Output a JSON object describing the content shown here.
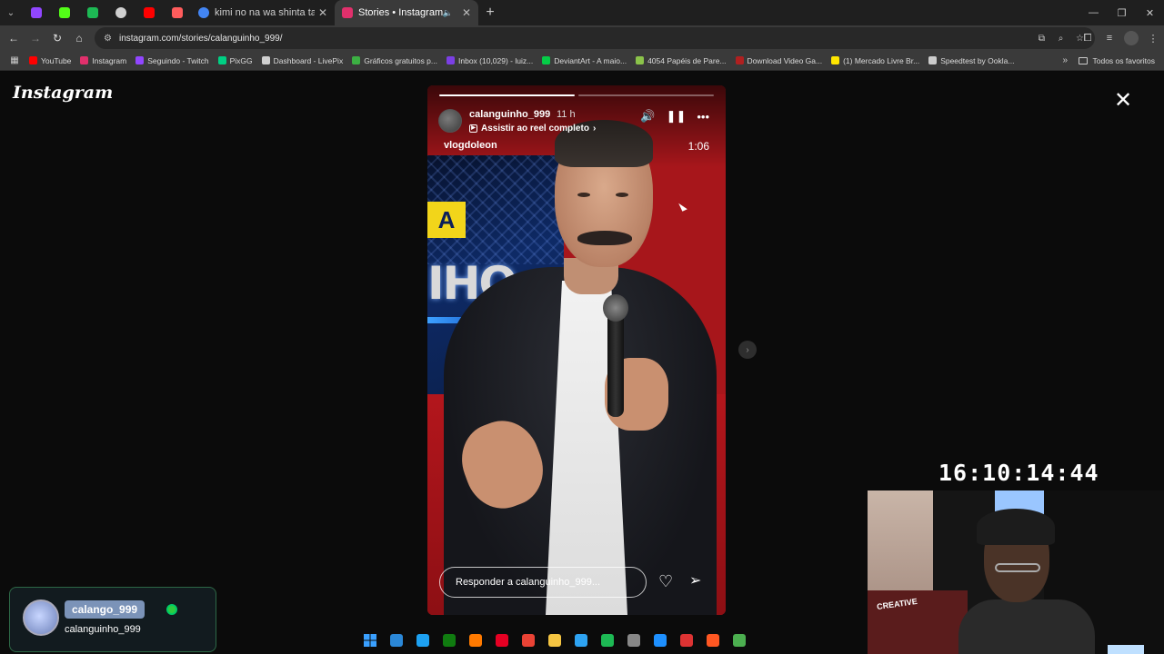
{
  "browser": {
    "tabs": [
      {
        "title": "kimi no na wa shinta takagi - P",
        "active": false,
        "favicon_color": "#4285f4"
      },
      {
        "title": "Stories • Instagram",
        "active": true,
        "favicon_color": "#e1306c"
      }
    ],
    "pinned_colors": [
      "#9146ff",
      "#53fc18",
      "#1db954",
      "#d0d0d0",
      "#ff0000",
      "#ff5c5c"
    ],
    "url": "instagram.com/stories/calanguinho_999/",
    "bookmarks": [
      {
        "label": "YouTube",
        "color": "#ff0000"
      },
      {
        "label": "Instagram",
        "color": "#e1306c"
      },
      {
        "label": "Seguindo - Twitch",
        "color": "#9146ff"
      },
      {
        "label": "PixGG",
        "color": "#00d084"
      },
      {
        "label": "Dashboard - LivePix",
        "color": "#cfcfcf"
      },
      {
        "label": "Gráficos gratuitos p...",
        "color": "#3cb043"
      },
      {
        "label": "Inbox (10,029) - luiz...",
        "color": "#7b3fe4"
      },
      {
        "label": "DeviantArt - A maio...",
        "color": "#05cc47"
      },
      {
        "label": "4054 Papéis de Pare...",
        "color": "#8bc34a"
      },
      {
        "label": "Download Video Ga...",
        "color": "#b02020"
      },
      {
        "label": "(1) Mercado Livre Br...",
        "color": "#ffe600"
      },
      {
        "label": "Speedtest by Ookla...",
        "color": "#cccccc"
      }
    ],
    "all_bookmarks_label": "Todos os favoritos"
  },
  "instagram": {
    "logo": "Instagram",
    "story": {
      "username": "calanguinho_999",
      "time_ago": "11 h",
      "reel_link": "Assistir ao reel completo",
      "overlay_name": "vlogdoleon",
      "video_time": "1:06",
      "sign_letter": "A",
      "sign_text": "IHO",
      "reply_placeholder": "Responder a calanguinho_999...",
      "progress": [
        1.0,
        0.0
      ]
    }
  },
  "overlays": {
    "clock": "16:10:14:44",
    "chat_name": "calango_999",
    "chat_handle": "calanguinho_999",
    "webcam_brand": "CREATIVE"
  },
  "taskbar_colors": [
    "#3aa0ff",
    "#2b88d8",
    "#1da1f2",
    "#107c10",
    "#ff7a00",
    "#e60023",
    "#ea4335",
    "#f5c542",
    "#2ea3f2",
    "#1db954",
    "#888888",
    "#1e90ff",
    "#d33",
    "#ff5722",
    "#4caf50"
  ]
}
